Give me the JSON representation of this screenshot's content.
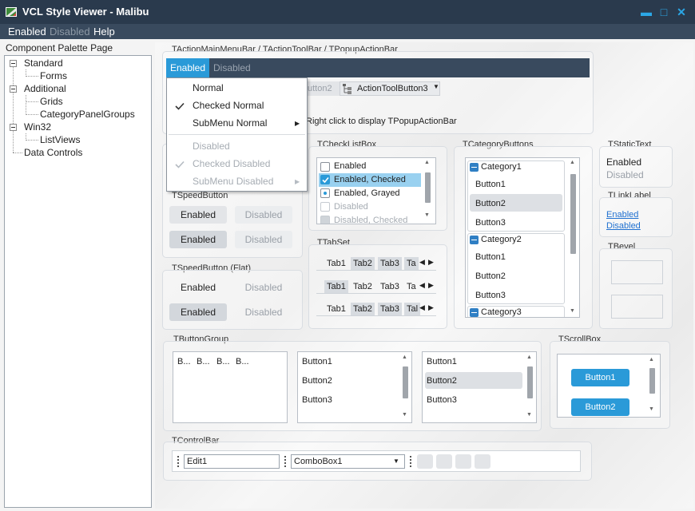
{
  "window": {
    "title": "VCL Style Viewer - Malibu",
    "minimize_glyph": "▬",
    "maximize_glyph": "□",
    "close_glyph": "✕"
  },
  "menubar": {
    "items": [
      "Enabled",
      "Disabled",
      "Help"
    ]
  },
  "left": {
    "caption": "Component Palette Page",
    "tree": {
      "standard": "Standard",
      "forms": "Forms",
      "additional": "Additional",
      "grids": "Grids",
      "catpanel": "CategoryPanelGroups",
      "win32": "Win32",
      "listviews": "ListViews",
      "datacontrols": "Data Controls"
    }
  },
  "actionbar": {
    "caption": "TActionMainMenuBar / TActionToolBar / TPopupActionBar",
    "menu_enabled": "Enabled",
    "menu_disabled": "Disabled",
    "toolbtn2": "utton2",
    "toolbtn3": "ActionToolButton3",
    "popup_hint": "Right click to display TPopupActionBar"
  },
  "popup": {
    "normal": "Normal",
    "checked_normal": "Checked Normal",
    "submenu_normal": "SubMenu Normal",
    "disabled": "Disabled",
    "checked_disabled": "Checked Disabled",
    "submenu_disabled": "SubMenu Disabled"
  },
  "speedbutton": {
    "caption": "TSpeedButton",
    "enabled": "Enabled",
    "disabled": "Disabled"
  },
  "speedbutton_flat": {
    "caption": "TSpeedButton (Flat)",
    "enabled": "Enabled",
    "disabled": "Disabled"
  },
  "checklistbox": {
    "caption": "TCheckListBox",
    "items": [
      "Enabled",
      "Enabled, Checked",
      "Enabled, Grayed",
      "Disabled",
      "Disabled, Checked"
    ]
  },
  "tabset": {
    "caption": "TTabSet",
    "tabs": [
      "Tab1",
      "Tab2",
      "Tab3",
      "Ta",
      "Tab1",
      "Tab2",
      "Tab3",
      "Ta",
      "Tab1",
      "Tab2",
      "Tab3",
      "Tal"
    ]
  },
  "categorybuttons": {
    "caption": "TCategoryButtons",
    "cat1": "Category1",
    "cat2": "Category2",
    "cat3": "Category3",
    "b1": "Button1",
    "b2": "Button2",
    "b3": "Button3"
  },
  "statictext": {
    "caption": "TStaticText",
    "enabled": "Enabled",
    "disabled": "Disabled"
  },
  "linklabel": {
    "caption": "TLinkLabel",
    "enabled": "Enabled",
    "disabled": "Disabled"
  },
  "bevel": {
    "caption": "TBevel"
  },
  "buttongroup": {
    "caption": "TButtonGroup",
    "items": [
      "B...",
      "B...",
      "B..."
    ],
    "list1": [
      "Button1",
      "Button2",
      "Button3"
    ],
    "list2": [
      "Button1",
      "Button2",
      "Button3"
    ]
  },
  "scrollbox": {
    "caption": "TScrollBox",
    "b1": "Button1",
    "b2": "Button2"
  },
  "controlbar": {
    "caption": "TControlBar",
    "edit": "Edit1",
    "combo": "ComboBox1"
  },
  "colors": {
    "accent": "#2a9ad8",
    "titlebar": "#2a3a4d",
    "menubar": "#394a5e",
    "selection": "#99d1f0"
  }
}
